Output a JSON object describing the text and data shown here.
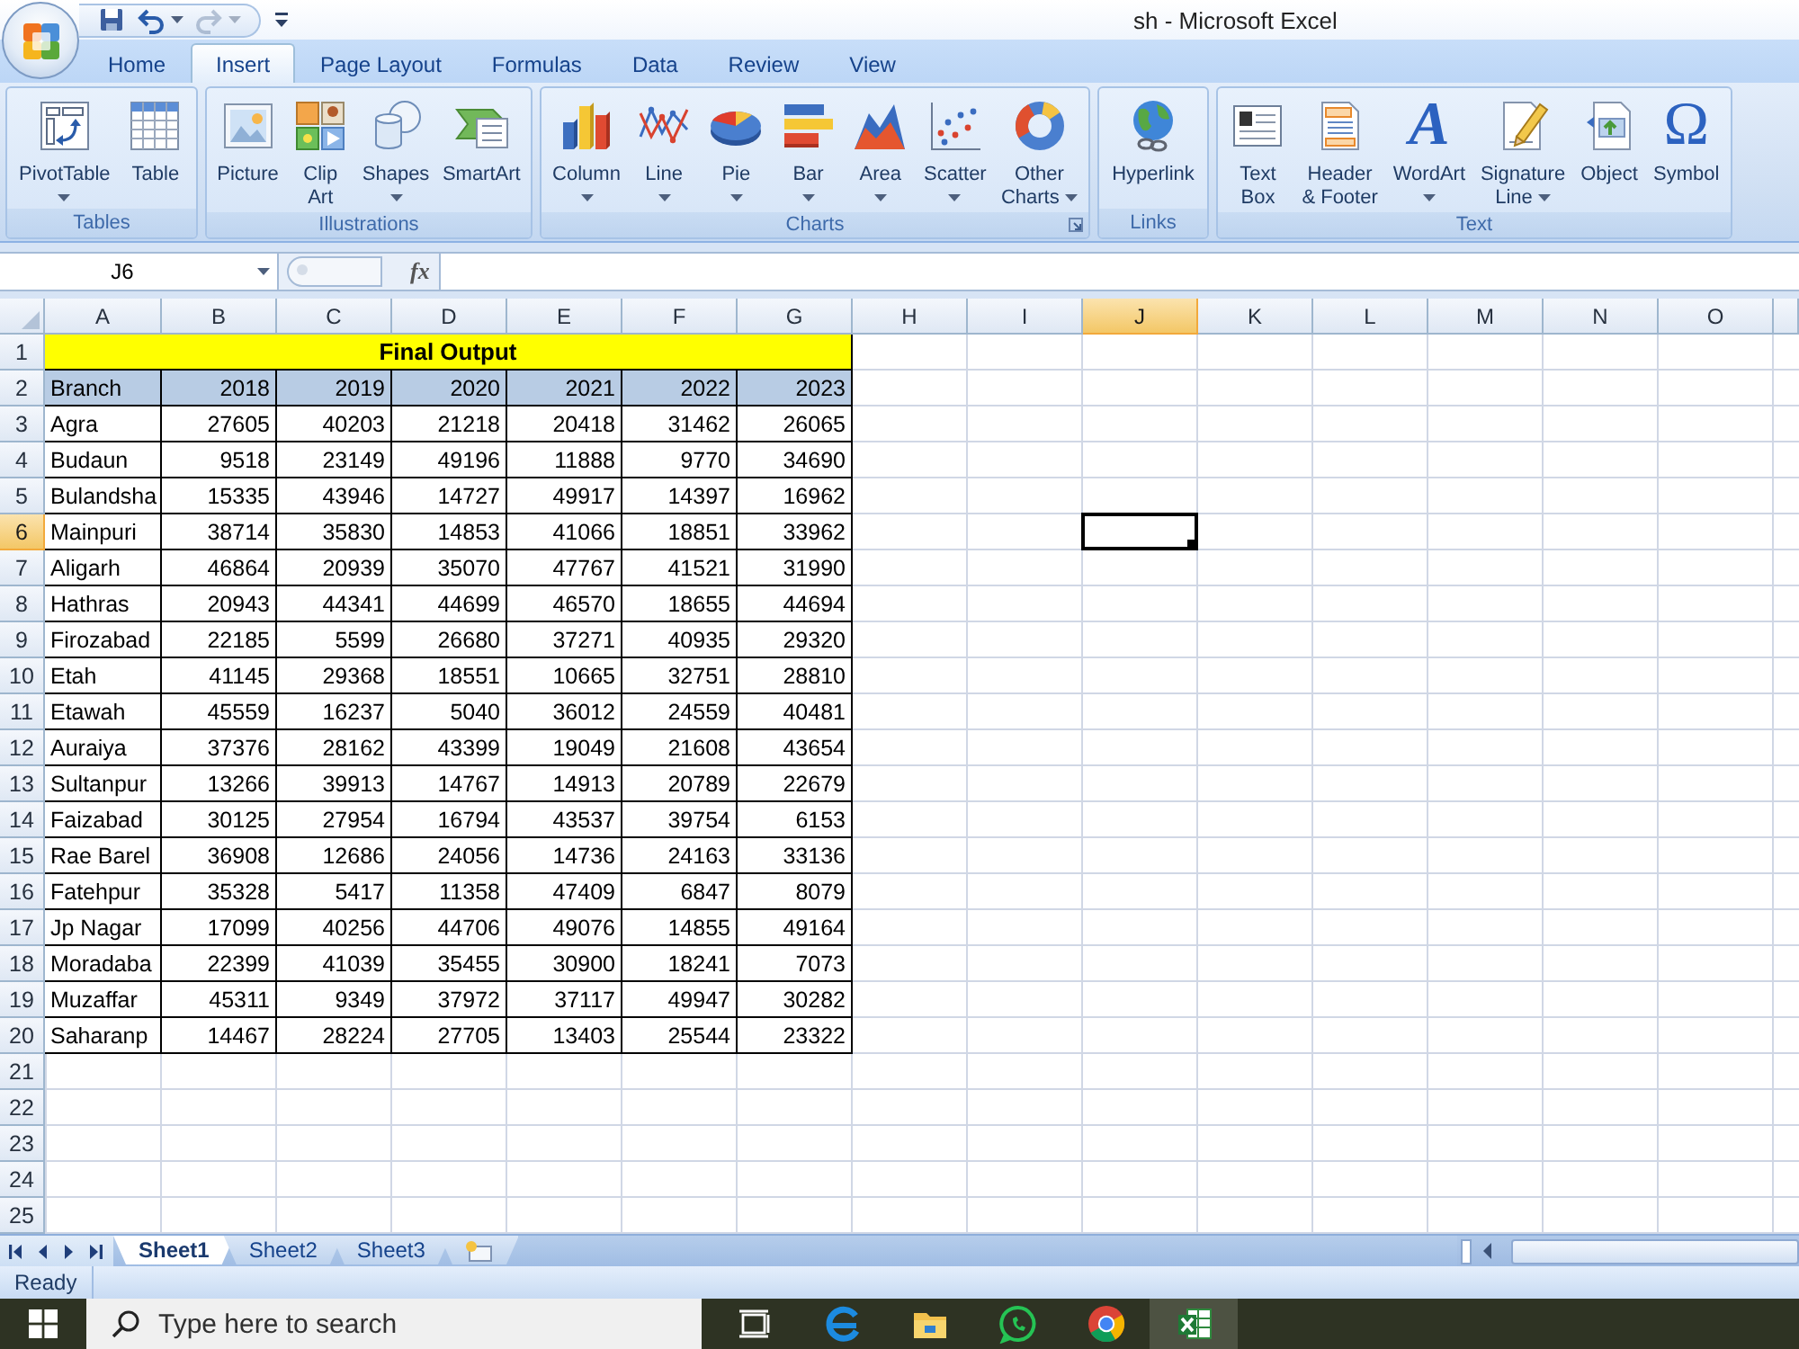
{
  "window": {
    "title": "sh - Microsoft Excel"
  },
  "quick_access": [
    {
      "disabled": false,
      "dropdown": false
    },
    {
      "disabled": false,
      "dropdown": true
    },
    {
      "disabled": true,
      "dropdown": true
    }
  ],
  "ribbon_tabs": [
    {
      "label": "Home",
      "selected": false
    },
    {
      "label": "Insert",
      "selected": true
    },
    {
      "label": "Page Layout",
      "selected": false
    },
    {
      "label": "Formulas",
      "selected": false
    },
    {
      "label": "Data",
      "selected": false
    },
    {
      "label": "Review",
      "selected": false
    },
    {
      "label": "View",
      "selected": false
    }
  ],
  "ribbon_groups": [
    {
      "label": "Tables",
      "dialog_launcher": false,
      "buttons": [
        {
          "lines": [
            "PivotTable"
          ],
          "dropdown": true
        },
        {
          "lines": [
            "Table"
          ],
          "dropdown": false
        }
      ]
    },
    {
      "label": "Illustrations",
      "dialog_launcher": false,
      "buttons": [
        {
          "lines": [
            "Picture"
          ],
          "dropdown": false
        },
        {
          "lines": [
            "Clip",
            "Art"
          ],
          "dropdown": false
        },
        {
          "lines": [
            "Shapes"
          ],
          "dropdown": true
        },
        {
          "lines": [
            "SmartArt"
          ],
          "dropdown": false
        }
      ]
    },
    {
      "label": "Charts",
      "dialog_launcher": true,
      "buttons": [
        {
          "lines": [
            "Column"
          ],
          "dropdown": true
        },
        {
          "lines": [
            "Line"
          ],
          "dropdown": true
        },
        {
          "lines": [
            "Pie"
          ],
          "dropdown": true
        },
        {
          "lines": [
            "Bar"
          ],
          "dropdown": true
        },
        {
          "lines": [
            "Area"
          ],
          "dropdown": true
        },
        {
          "lines": [
            "Scatter"
          ],
          "dropdown": true
        },
        {
          "lines": [
            "Other",
            "Charts"
          ],
          "dropdown": true
        }
      ]
    },
    {
      "label": "Links",
      "dialog_launcher": false,
      "buttons": [
        {
          "lines": [
            "Hyperlink"
          ],
          "dropdown": false
        }
      ]
    },
    {
      "label": "Text",
      "dialog_launcher": false,
      "buttons": [
        {
          "lines": [
            "Text",
            "Box"
          ],
          "dropdown": false
        },
        {
          "lines": [
            "Header",
            "& Footer"
          ],
          "dropdown": false
        },
        {
          "lines": [
            "WordArt"
          ],
          "dropdown": true,
          "glyph": "A"
        },
        {
          "lines": [
            "Signature",
            "Line"
          ],
          "dropdown": true
        },
        {
          "lines": [
            "Object"
          ],
          "dropdown": false
        },
        {
          "lines": [
            "Symbol"
          ],
          "dropdown": false,
          "glyph": "Ω"
        }
      ]
    }
  ],
  "formula_bar": {
    "name_box": "J6",
    "function_button": "fx"
  },
  "sheet": {
    "columns": [
      {
        "label": "A",
        "selected": false
      },
      {
        "label": "B",
        "selected": false
      },
      {
        "label": "C",
        "selected": false
      },
      {
        "label": "D",
        "selected": false
      },
      {
        "label": "E",
        "selected": false
      },
      {
        "label": "F",
        "selected": false
      },
      {
        "label": "G",
        "selected": false
      },
      {
        "label": "H",
        "selected": false
      },
      {
        "label": "I",
        "selected": false
      },
      {
        "label": "J",
        "selected": true
      },
      {
        "label": "K",
        "selected": false
      },
      {
        "label": "L",
        "selected": false
      },
      {
        "label": "M",
        "selected": false
      },
      {
        "label": "N",
        "selected": false
      },
      {
        "label": "O",
        "selected": false
      }
    ],
    "rows": [
      {
        "label": "1",
        "selected": false
      },
      {
        "label": "2",
        "selected": false
      },
      {
        "label": "3",
        "selected": false
      },
      {
        "label": "4",
        "selected": false
      },
      {
        "label": "5",
        "selected": false
      },
      {
        "label": "6",
        "selected": true
      },
      {
        "label": "7",
        "selected": false
      },
      {
        "label": "8",
        "selected": false
      },
      {
        "label": "9",
        "selected": false
      },
      {
        "label": "10",
        "selected": false
      },
      {
        "label": "11",
        "selected": false
      },
      {
        "label": "12",
        "selected": false
      },
      {
        "label": "13",
        "selected": false
      },
      {
        "label": "14",
        "selected": false
      },
      {
        "label": "15",
        "selected": false
      },
      {
        "label": "16",
        "selected": false
      },
      {
        "label": "17",
        "selected": false
      },
      {
        "label": "18",
        "selected": false
      },
      {
        "label": "19",
        "selected": false
      },
      {
        "label": "20",
        "selected": false
      },
      {
        "label": "21",
        "selected": false
      },
      {
        "label": "22",
        "selected": false
      },
      {
        "label": "23",
        "selected": false
      },
      {
        "label": "24",
        "selected": false
      },
      {
        "label": "25",
        "selected": false
      }
    ],
    "title": "Final Output",
    "header": [
      "Branch",
      "2018",
      "2019",
      "2020",
      "2021",
      "2022",
      "2023"
    ],
    "data": [
      [
        "Agra",
        "27605",
        "40203",
        "21218",
        "20418",
        "31462",
        "26065"
      ],
      [
        "Budaun",
        "9518",
        "23149",
        "49196",
        "11888",
        "9770",
        "34690"
      ],
      [
        "Bulandsha",
        "15335",
        "43946",
        "14727",
        "49917",
        "14397",
        "16962"
      ],
      [
        "Mainpuri",
        "38714",
        "35830",
        "14853",
        "41066",
        "18851",
        "33962"
      ],
      [
        "Aligarh",
        "46864",
        "20939",
        "35070",
        "47767",
        "41521",
        "31990"
      ],
      [
        "Hathras",
        "20943",
        "44341",
        "44699",
        "46570",
        "18655",
        "44694"
      ],
      [
        "Firozabad",
        "22185",
        "5599",
        "26680",
        "37271",
        "40935",
        "29320"
      ],
      [
        "Etah",
        "41145",
        "29368",
        "18551",
        "10665",
        "32751",
        "28810"
      ],
      [
        "Etawah",
        "45559",
        "16237",
        "5040",
        "36012",
        "24559",
        "40481"
      ],
      [
        "Auraiya",
        "37376",
        "28162",
        "43399",
        "19049",
        "21608",
        "43654"
      ],
      [
        "Sultanpur",
        "13266",
        "39913",
        "14767",
        "14913",
        "20789",
        "22679"
      ],
      [
        "Faizabad",
        "30125",
        "27954",
        "16794",
        "43537",
        "39754",
        "6153"
      ],
      [
        "Rae Barel",
        "36908",
        "12686",
        "24056",
        "14736",
        "24163",
        "33136"
      ],
      [
        "Fatehpur",
        "35328",
        "5417",
        "11358",
        "47409",
        "6847",
        "8079"
      ],
      [
        "Jp Nagar",
        "17099",
        "40256",
        "44706",
        "49076",
        "14855",
        "49164"
      ],
      [
        "Moradaba",
        "22399",
        "41039",
        "35455",
        "30900",
        "18241",
        "7073"
      ],
      [
        "Muzaffar",
        "45311",
        "9349",
        "37972",
        "37117",
        "49947",
        "30282"
      ],
      [
        "Saharanp",
        "14467",
        "28224",
        "27705",
        "13403",
        "25544",
        "23322"
      ]
    ]
  },
  "sheet_tabs": [
    {
      "label": "Sheet1",
      "selected": true
    },
    {
      "label": "Sheet2",
      "selected": false
    },
    {
      "label": "Sheet3",
      "selected": false
    }
  ],
  "status_bar": {
    "text": "Ready"
  },
  "taskbar": {
    "search": {
      "placeholder": "Type here to search"
    },
    "apps": [
      {
        "selected": false
      },
      {
        "selected": false
      },
      {
        "selected": false
      },
      {
        "selected": false
      },
      {
        "selected": false
      },
      {
        "selected": true
      }
    ]
  }
}
